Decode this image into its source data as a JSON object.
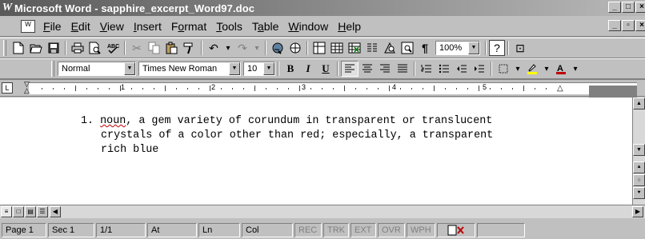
{
  "window": {
    "title": "Microsoft Word - sapphire_excerpt_Word97.doc"
  },
  "menu": {
    "items": [
      {
        "label": "File",
        "mnemonic": "F",
        "rest": "ile"
      },
      {
        "label": "Edit",
        "mnemonic": "E",
        "rest": "dit"
      },
      {
        "label": "View",
        "mnemonic": "V",
        "rest": "iew"
      },
      {
        "label": "Insert",
        "mnemonic": "I",
        "rest": "nsert"
      },
      {
        "label": "Format",
        "pre": "F",
        "mnemonic": "o",
        "rest": "rmat"
      },
      {
        "label": "Tools",
        "mnemonic": "T",
        "rest": "ools"
      },
      {
        "label": "Table",
        "pre": "T",
        "mnemonic": "a",
        "rest": "ble"
      },
      {
        "label": "Window",
        "mnemonic": "W",
        "rest": "indow"
      },
      {
        "label": "Help",
        "mnemonic": "H",
        "rest": "elp"
      }
    ]
  },
  "standard_toolbar": {
    "zoom": "100%"
  },
  "formatting_toolbar": {
    "style": "Normal",
    "font": "Times New Roman",
    "size": "10",
    "bold": "B",
    "italic": "I",
    "underline": "U"
  },
  "ruler": {
    "numbers": [
      "1",
      "2",
      "3",
      "4",
      "5"
    ]
  },
  "document": {
    "list_number": "1.",
    "word_noun": "noun",
    "line1_rest": ", a gem variety of corundum in transparent or translucent",
    "line2": "crystals of a color other than red; especially, a transparent",
    "line3": "rich blue"
  },
  "status": {
    "page": "Page 1",
    "sec": "Sec 1",
    "pages": "1/1",
    "at": "At",
    "ln": "Ln",
    "col": "Col",
    "rec": "REC",
    "trk": "TRK",
    "ext": "EXT",
    "ovr": "OVR",
    "wph": "WPH"
  }
}
